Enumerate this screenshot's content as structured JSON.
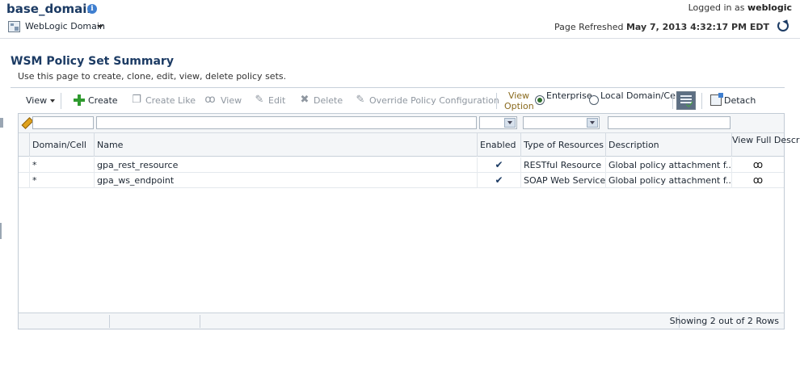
{
  "header": {
    "domain_title": "base_domain",
    "logged_in_label": "Logged in as",
    "user": "weblogic",
    "domain_menu": "WebLogic Domain",
    "refreshed_label": "Page Refreshed",
    "refreshed_time": "May 7, 2013 4:32:17 PM EDT"
  },
  "page": {
    "title": "WSM Policy Set Summary",
    "description": "Use this page to create, clone, edit, view, delete policy sets."
  },
  "toolbar": {
    "view": "View",
    "create": "Create",
    "create_like": "Create Like",
    "view_action": "View",
    "edit": "Edit",
    "delete": "Delete",
    "override": "Override Policy Configuration",
    "view_option": "View Option",
    "enterprise": "Enterprise",
    "local": "Local Domain/Cell",
    "detach": "Detach",
    "selected_option": "Enterprise"
  },
  "table": {
    "columns": [
      "Domain/Cell",
      "Name",
      "Enabled",
      "Type of Resources",
      "Description",
      "View Full Description"
    ],
    "rows": [
      {
        "domain": "*",
        "name": "gpa_rest_resource",
        "enabled": "✔",
        "type": "RESTful Resource",
        "description": "Global policy attachment f...",
        "view": "ඉ"
      },
      {
        "domain": "*",
        "name": "gpa_ws_endpoint",
        "enabled": "✔",
        "type": "SOAP Web Service",
        "description": "Global policy attachment f...",
        "view": "ඉ"
      }
    ],
    "status": "Showing 2 out of 2 Rows"
  },
  "colors": {
    "title": "#1c3b64",
    "accent_green": "#2f9a2f",
    "view_option_label": "#8a6b1f"
  }
}
